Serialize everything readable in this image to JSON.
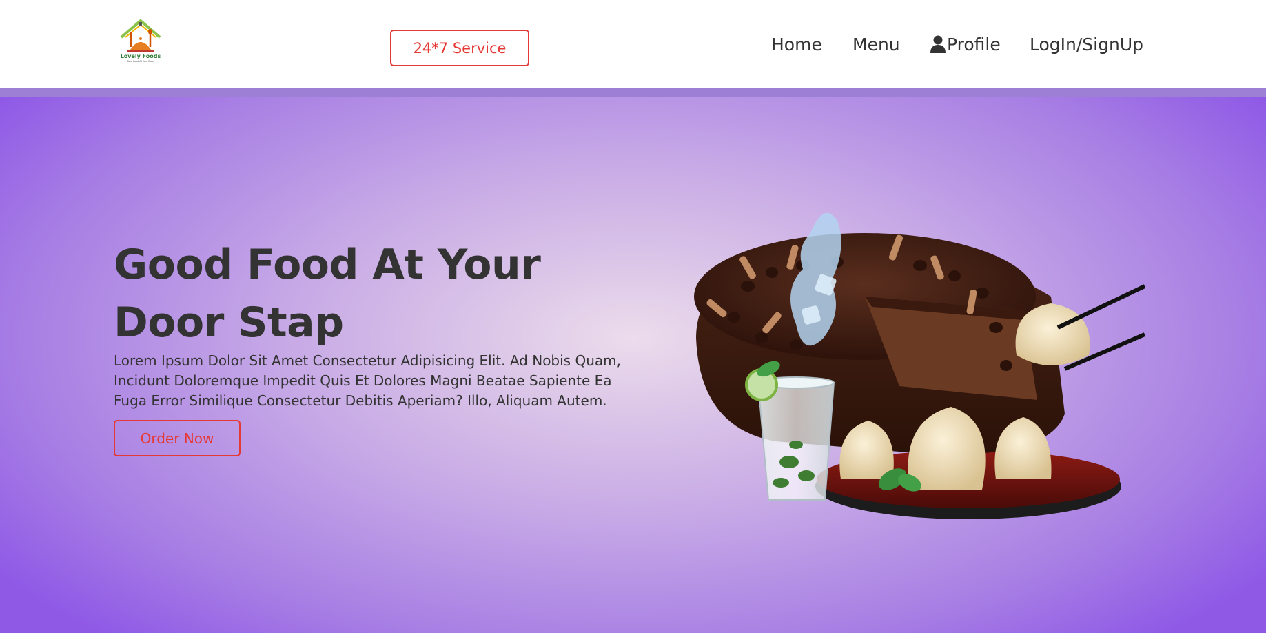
{
  "header": {
    "logo_text": "Lovely Foods",
    "logo_tagline": "Best Food At Your Door",
    "service_button": "24*7 Service",
    "nav": {
      "home": "Home",
      "menu": "Menu",
      "profile": "Profile",
      "login": "LogIn/SignUp"
    }
  },
  "hero": {
    "title": "Good Food At Your Door Stap",
    "description": "Lorem Ipsum Dolor Sit Amet Consectetur Adipisicing Elit. Ad Nobis Quam, Incidunt Doloremque Impedit Quis Et Dolores Magni Beatae Sapiente Ea Fuga Error Similique Consectetur Debitis Aperiam? Illo, Aliquam Autem.",
    "order_button": "Order Now"
  },
  "colors": {
    "accent": "#e53935",
    "text": "#333333",
    "hero_center": "#ecdcec",
    "hero_edge": "#8f59e6"
  }
}
